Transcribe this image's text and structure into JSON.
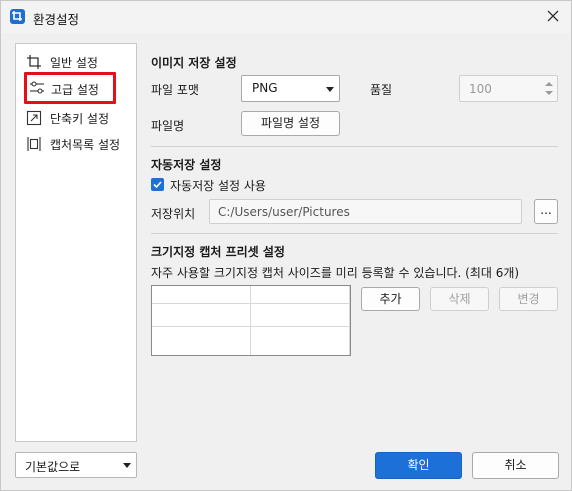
{
  "window": {
    "title": "환경설정"
  },
  "nav": {
    "items": [
      {
        "label": "일반 설정",
        "icon": "crop-icon"
      },
      {
        "label": "고급 설정",
        "icon": "sliders-icon",
        "active": true
      },
      {
        "label": "단축키 설정",
        "icon": "shortcut-arrow-icon"
      },
      {
        "label": "캡처목록 설정",
        "icon": "capture-list-icon"
      }
    ]
  },
  "defaults": {
    "selected": "기본값으로"
  },
  "image_save": {
    "title": "이미지 저장 설정",
    "format_label": "파일 포맷",
    "format_value": "PNG",
    "quality_label": "품질",
    "quality_value": "100",
    "filename_label": "파일명",
    "filename_button": "파일명 설정"
  },
  "auto_save": {
    "title": "자동저장 설정",
    "checkbox_label": "자동저장 설정 사용",
    "checked": true,
    "location_label": "저장위치",
    "location_value": "C:/Users/user/Pictures",
    "browse_button": "..."
  },
  "preset": {
    "title": "크기지정 캡처 프리셋 설정",
    "description": "자주 사용할 크기지정 캡처 사이즈를 미리 등록할 수 있습니다. (최대 6개)",
    "add_button": "추가",
    "delete_button": "삭제",
    "edit_button": "변경"
  },
  "footer": {
    "ok_button": "확인",
    "cancel_button": "취소"
  },
  "colors": {
    "accent": "#1c70d8",
    "highlight": "#e3101c"
  }
}
